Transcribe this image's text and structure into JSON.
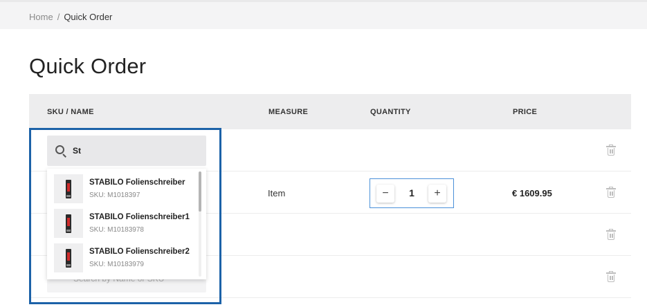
{
  "breadcrumb": {
    "home": "Home",
    "separator": "/",
    "current": "Quick Order"
  },
  "page_title": "Quick Order",
  "table": {
    "headers": {
      "sku_name": "SKU / NAME",
      "measure": "MEASURE",
      "quantity": "QUANTITY",
      "price": "PRICE"
    },
    "rows": [
      {
        "measure": "",
        "quantity": "",
        "price": ""
      },
      {
        "measure": "Item",
        "quantity": "1",
        "price": "€ 1609.95"
      },
      {
        "measure": "",
        "quantity": "",
        "price": ""
      },
      {
        "measure": "",
        "quantity": "",
        "price": ""
      }
    ]
  },
  "quantity_controls": {
    "minus": "−",
    "plus": "+"
  },
  "search": {
    "value": "St",
    "placeholder": "Search by Name or SKU"
  },
  "suggestions": [
    {
      "name": "STABILO Folienschreiber",
      "sku": "SKU: M1018397"
    },
    {
      "name": "STABILO Folienschreiber1",
      "sku": "SKU: M10183978"
    },
    {
      "name": "STABILO Folienschreiber2",
      "sku": "SKU: M10183979"
    }
  ],
  "colors": {
    "highlight": "#1c62a8",
    "quantity_border": "#4a90d9",
    "header_bg": "#ededee"
  },
  "icons": {
    "search": "search-icon",
    "delete": "trash-icon",
    "product": "product-thumbnail"
  }
}
